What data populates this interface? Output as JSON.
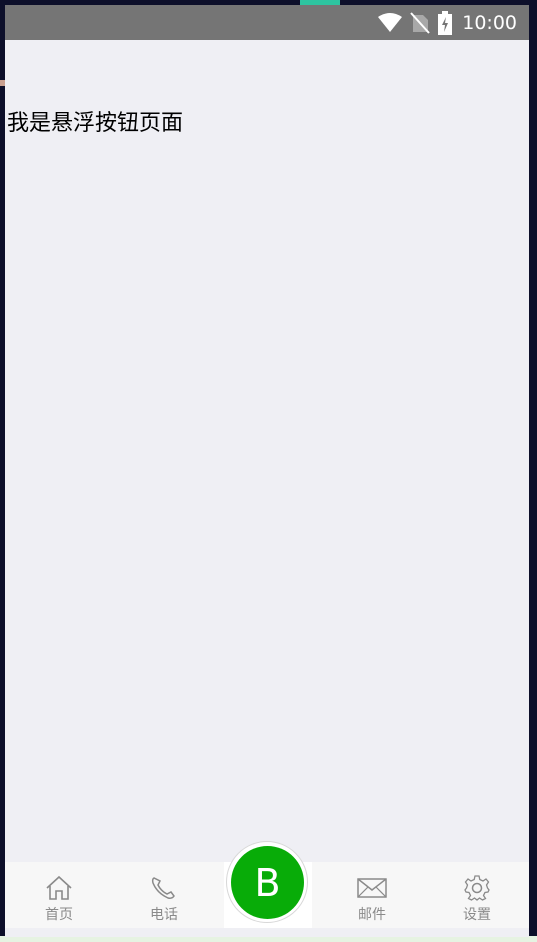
{
  "status_bar": {
    "time": "10:00",
    "icons": [
      "wifi-icon",
      "no-sim-icon",
      "battery-charging-icon"
    ]
  },
  "page": {
    "text": "我是悬浮按钮页面"
  },
  "tabbar": {
    "tabs": [
      {
        "label": "首页",
        "icon": "home-icon"
      },
      {
        "label": "电话",
        "icon": "phone-icon"
      },
      {
        "label": "邮件",
        "icon": "mail-icon"
      },
      {
        "label": "设置",
        "icon": "gear-icon"
      }
    ],
    "fab_label": "B"
  },
  "colors": {
    "status_bar": "#757575",
    "background": "#efeff4",
    "fab": "#08ac08",
    "tab_text": "#8a8a8a"
  }
}
